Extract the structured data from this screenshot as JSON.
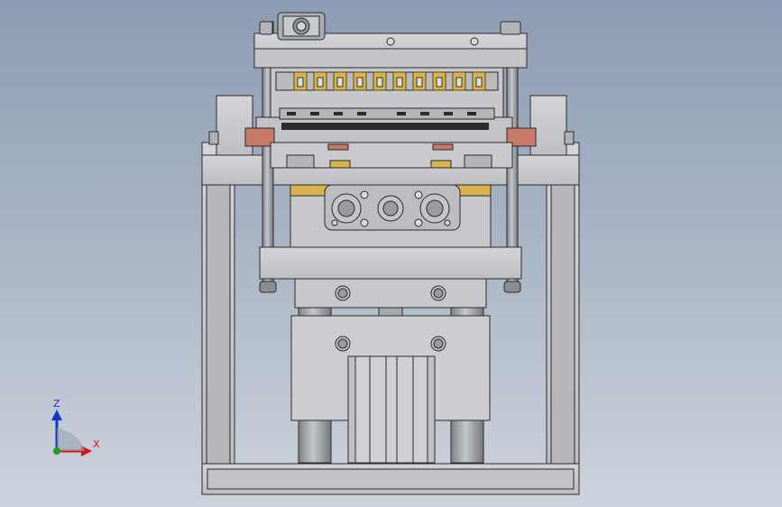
{
  "viewport": {
    "background_top": "#8c9cb4",
    "background_bottom": "#ccd3dc",
    "model": "press-fixture-assembly"
  },
  "colors": {
    "steel": "#c9c9cd",
    "steel_dark": "#9a9aa0",
    "edge": "#2b2b2b",
    "brass": "#d8b24a",
    "copper": "#c77a67",
    "rod": "#9ea3a8"
  },
  "triad": {
    "z_label": "Z",
    "x_label": "X",
    "z_color": "#1a2fd0",
    "x_color": "#d01a1a",
    "origin_color": "#1aa01a"
  }
}
